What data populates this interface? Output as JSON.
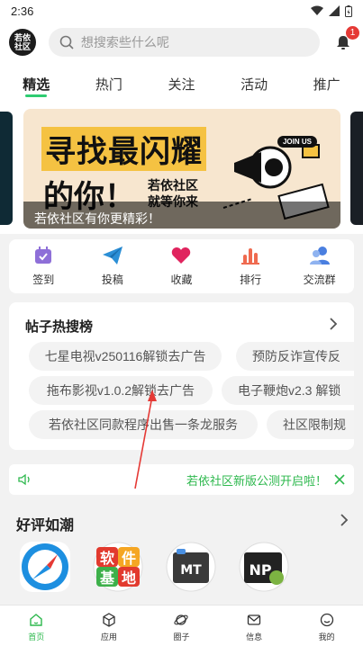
{
  "status_bar": {
    "time": "2:36"
  },
  "header": {
    "logo_text": "若依社区",
    "search_placeholder": "想搜索些什么呢",
    "notification_count": "1"
  },
  "tabs": [
    {
      "label": "精选",
      "active": true
    },
    {
      "label": "热门",
      "active": false
    },
    {
      "label": "关注",
      "active": false
    },
    {
      "label": "活动",
      "active": false
    },
    {
      "label": "推广",
      "active": false
    }
  ],
  "banner": {
    "headline_1": "寻找最闪耀",
    "headline_2": "的你！",
    "sub_line_1": "若依社区",
    "sub_line_2": "就等你来",
    "join_label": "JOIN US",
    "caption": "若依社区有你更精彩！"
  },
  "quick_actions": [
    {
      "label": "签到",
      "icon": "calendar-icon",
      "color": "#8e6fd8"
    },
    {
      "label": "投稿",
      "icon": "paper-plane-icon",
      "color": "#2b8fd6"
    },
    {
      "label": "收藏",
      "icon": "heart-icon",
      "color": "#e0245e"
    },
    {
      "label": "排行",
      "icon": "bar-chart-icon",
      "color": "#ef6a4f"
    },
    {
      "label": "交流群",
      "icon": "group-icon",
      "color": "#4a7fe0"
    }
  ],
  "hot_search": {
    "title": "帖子热搜榜",
    "tags": [
      "七星电视v250116解锁去广告",
      "预防反诈宣传反",
      "拖布影视v1.0.2解锁去广告",
      "电子鞭炮v2.3 解锁",
      "若依社区同款程序出售一条龙服务",
      "社区限制规"
    ]
  },
  "notice": {
    "text": "若依社区新版公测开启啦！"
  },
  "praise": {
    "title": "好评如潮",
    "apps": [
      {
        "icon": "compass-app-icon"
      },
      {
        "icon": "software-base-app-icon",
        "text": [
          "软",
          "件",
          "基",
          "地"
        ]
      },
      {
        "icon": "mt-manager-app-icon",
        "text": "MT"
      },
      {
        "icon": "np-manager-app-icon",
        "text": "NP"
      }
    ]
  },
  "bottom_nav": [
    {
      "label": "首页",
      "active": true
    },
    {
      "label": "应用",
      "active": false
    },
    {
      "label": "圈子",
      "active": false
    },
    {
      "label": "信息",
      "active": false
    },
    {
      "label": "我的",
      "active": false
    }
  ],
  "colors": {
    "accent": "#2db84d",
    "badge": "#e53935"
  }
}
